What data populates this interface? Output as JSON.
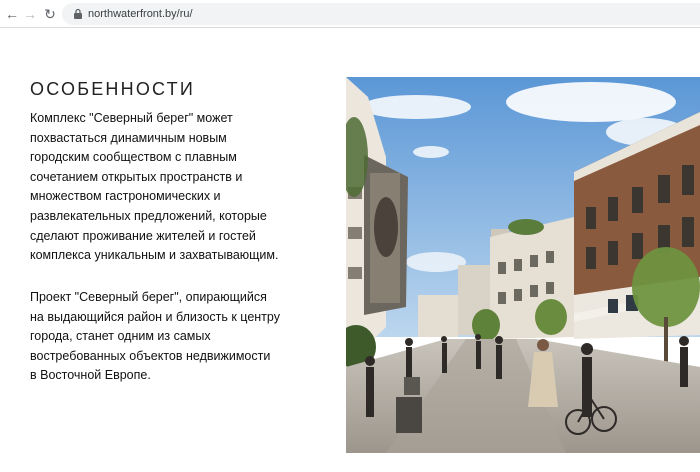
{
  "browser": {
    "url": "northwaterfront.by/ru/"
  },
  "icons": {
    "back": "arrow-left-icon",
    "forward": "arrow-right-icon",
    "reload": "reload-icon",
    "lock": "lock-icon"
  },
  "content": {
    "title": "ОСОБЕННОСТИ",
    "paragraph1_lines": [
      "Комплекс \"Северный берег\" может",
      "похвастаться динамичным новым",
      "городским сообществом с плавным",
      "сочетанием открытых пространств и",
      "множеством гастрономических и",
      "развлекательных предложений, которые",
      "сделают проживание жителей и гостей",
      "комплекса уникальным и захватывающим."
    ],
    "paragraph2_lines": [
      "Проект \"Северный берег\", опирающийся",
      "на выдающийся район и близость к центру",
      "города, станет одним из самых",
      "востребованных объектов недвижимости",
      "в Восточной Европе."
    ]
  },
  "colors": {
    "sky": "#6fa6dd",
    "brick": "#8a5a3e",
    "pavement": "#b9b4ac",
    "text": "#111111"
  }
}
